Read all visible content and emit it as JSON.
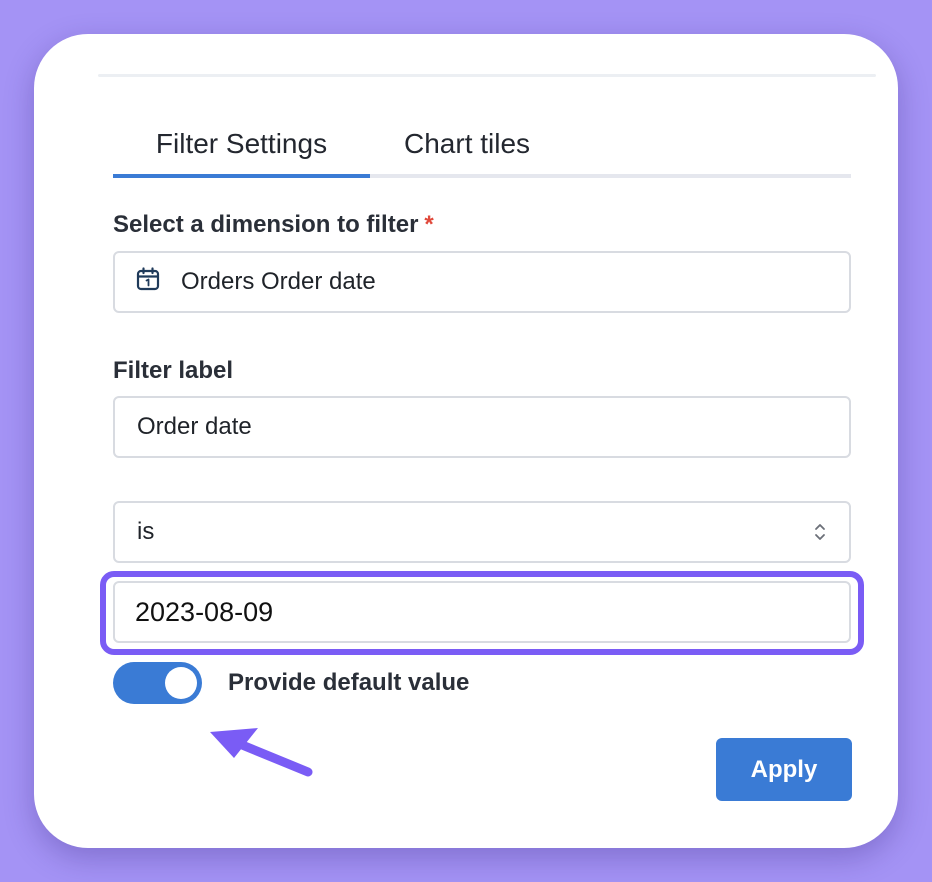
{
  "tabs": [
    {
      "label": "Filter Settings",
      "active": true
    },
    {
      "label": "Chart tiles",
      "active": false
    }
  ],
  "dimension": {
    "label": "Select a dimension to filter",
    "required_mark": "*",
    "value": "Orders Order date",
    "icon": "calendar-icon"
  },
  "filter_label": {
    "label": "Filter label",
    "value": "Order date"
  },
  "operator": {
    "value": "is",
    "icon": "chevron-updown-icon"
  },
  "value_field": {
    "value": "2023-08-09"
  },
  "default_toggle": {
    "label": "Provide default value",
    "on": true
  },
  "apply_button": {
    "label": "Apply"
  },
  "colors": {
    "background": "#a493f5",
    "accent": "#3a7bd5",
    "highlight": "#7a5cf5",
    "required": "#e0493b"
  }
}
